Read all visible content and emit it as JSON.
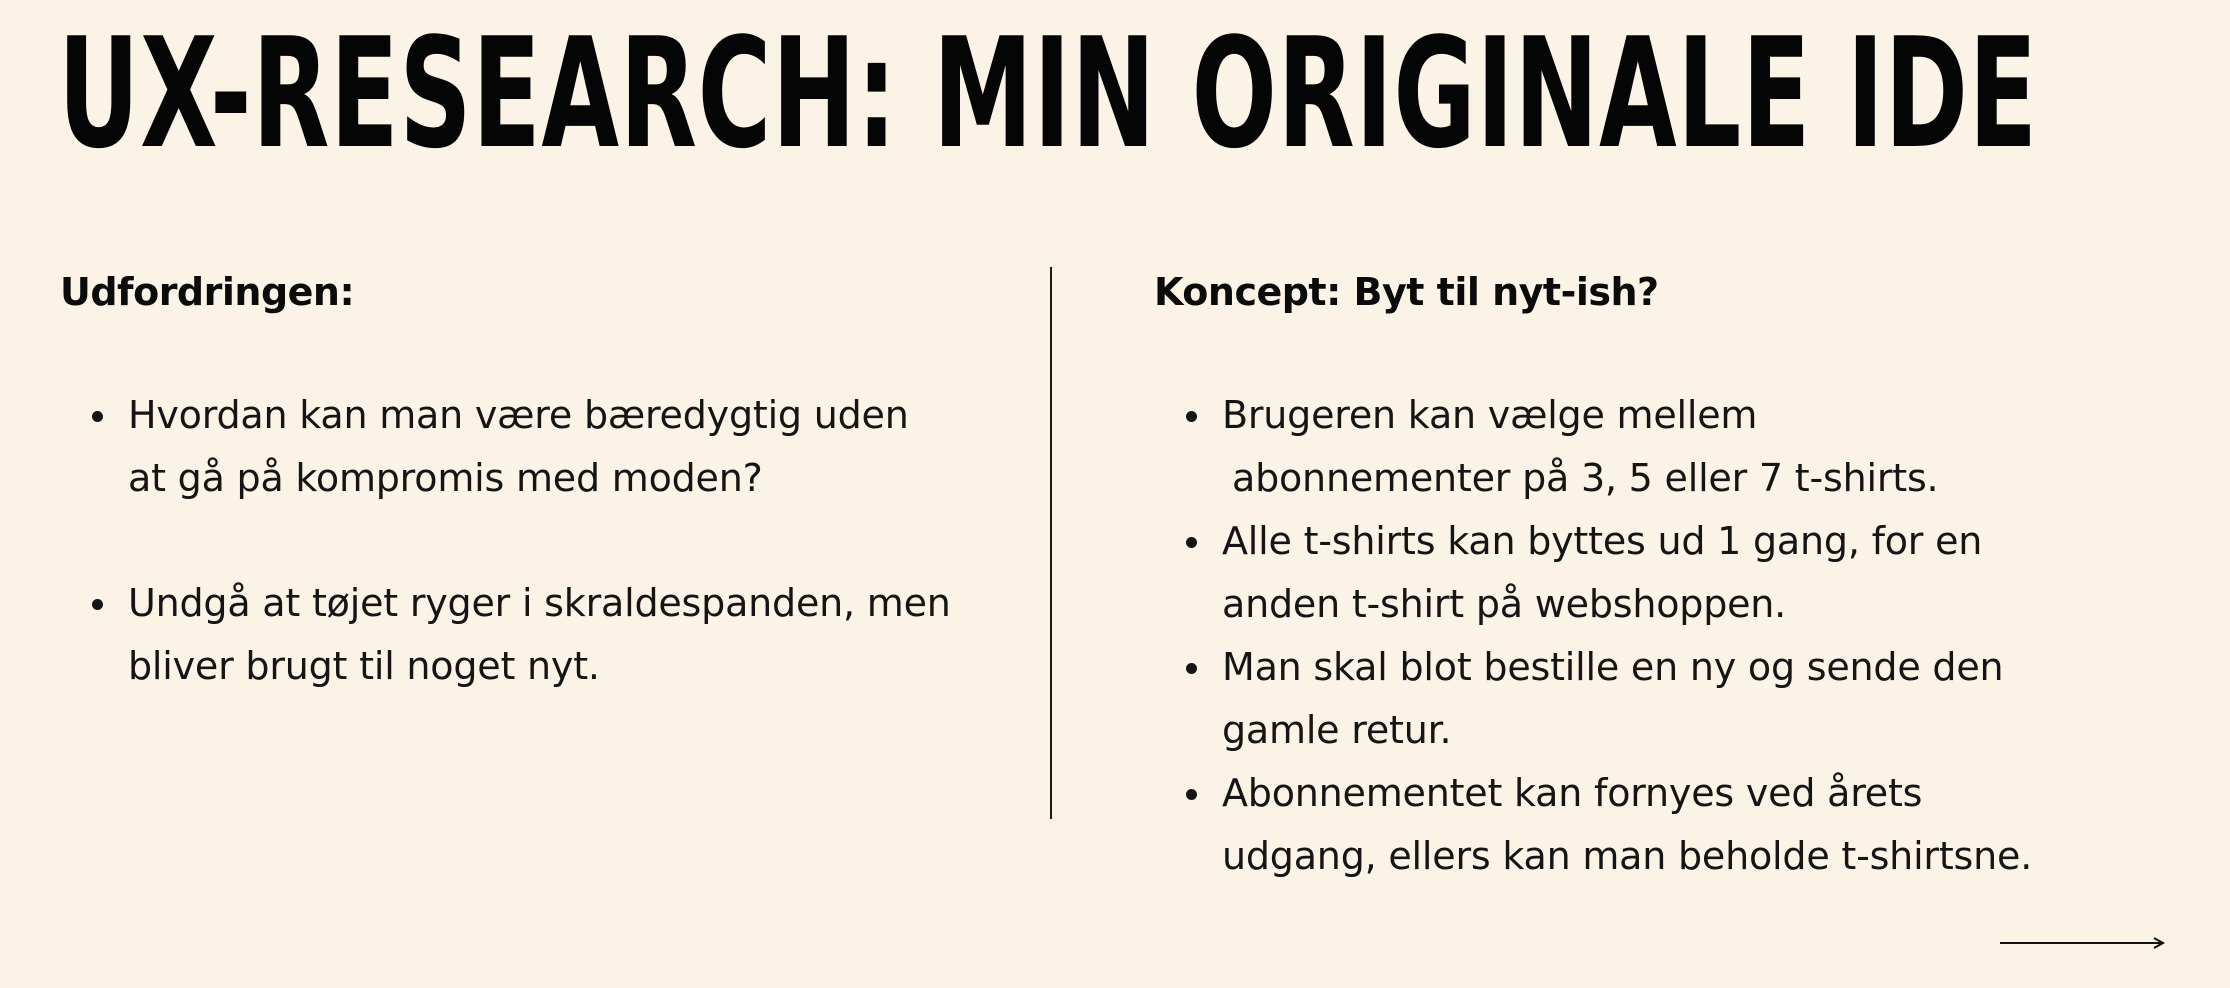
{
  "slide": {
    "title": "UX-RESEARCH: MIN ORIGINALE IDE",
    "left": {
      "heading": "Udfordringen:",
      "bullets": [
        {
          "lines": [
            "Hvordan kan man være bæredygtig uden",
            "at gå på kompromis med moden?"
          ]
        },
        {
          "lines": [
            "Undgå at tøjet ryger i skraldespanden, men",
            "bliver brugt til noget nyt."
          ]
        }
      ]
    },
    "right": {
      "heading": "Koncept: Byt til nyt-ish?",
      "bullets": [
        {
          "lines": [
            "Brugeren kan vælge mellem",
            "abonnementer på 3, 5 eller 7 t-shirts."
          ]
        },
        {
          "lines": [
            "Alle t-shirts kan byttes ud 1 gang, for en",
            "anden t-shirt på webshoppen."
          ]
        },
        {
          "lines": [
            "Man skal blot bestille en ny og sende den",
            "gamle retur."
          ]
        },
        {
          "lines": [
            "Abonnementet kan fornyes ved årets",
            "udgang, ellers kan man beholde t-shirtsne."
          ]
        }
      ]
    },
    "next_arrow_icon": "arrow-right-icon",
    "colors": {
      "background": "#fbf3e6",
      "text": "#111111"
    }
  }
}
